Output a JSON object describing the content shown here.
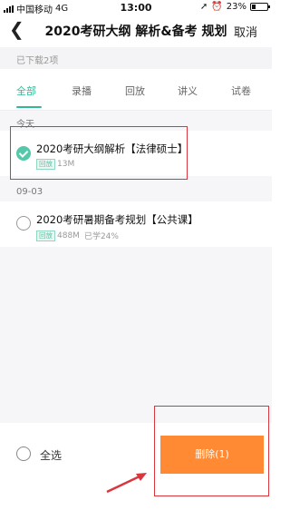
{
  "status_bar": {
    "carrier": "中国移动",
    "network": "4G",
    "time": "13:00",
    "battery": "23%",
    "battery_level": 0.23
  },
  "nav": {
    "title": "2020考研大纲 解析&备考 规划",
    "cancel": "取消"
  },
  "downloaded_note": "已下载2项",
  "tabs": [
    {
      "label": "全部",
      "active": true
    },
    {
      "label": "录播",
      "active": false
    },
    {
      "label": "回放",
      "active": false
    },
    {
      "label": "讲义",
      "active": false
    },
    {
      "label": "试卷",
      "active": false
    }
  ],
  "sections": [
    {
      "label": "今天",
      "items": [
        {
          "title": "2020考研大纲解析【法律硕士】",
          "badge": "回放",
          "size": "13M",
          "progress": "",
          "checked": true
        }
      ]
    },
    {
      "label": "09-03",
      "items": [
        {
          "title": "2020考研暑期备考规划【公共课】",
          "badge": "回放",
          "size": "488M",
          "progress": "已学24%",
          "checked": false
        }
      ]
    }
  ],
  "bottom": {
    "select_all": "全选",
    "delete": "删除(1)"
  },
  "colors": {
    "accent": "#2fb996",
    "delete_button": "#ff8a33",
    "highlight_box": "#d9363e"
  }
}
